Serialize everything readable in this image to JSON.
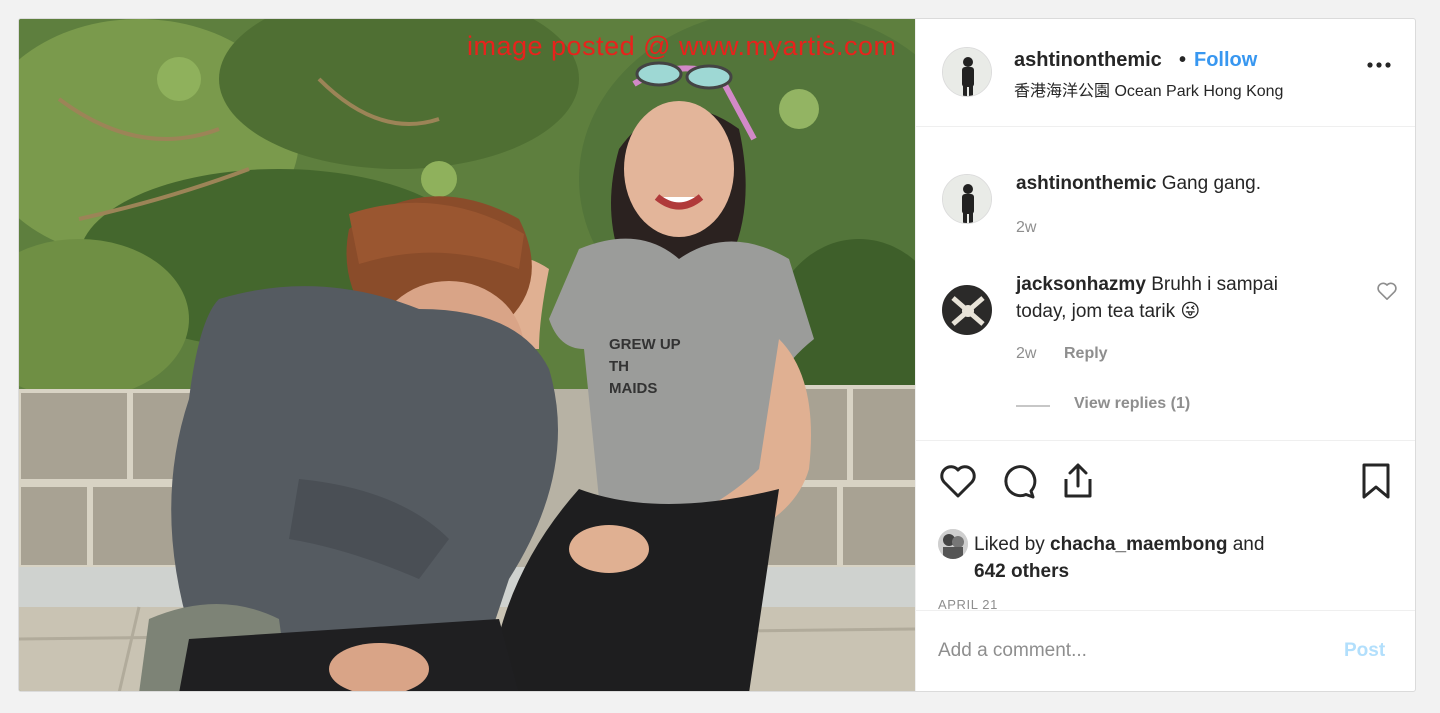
{
  "watermark": "image posted @ www.myartis.com",
  "photo": {
    "shirt_text_lines": [
      "GREW UP",
      "TH",
      "MAIDS"
    ]
  },
  "header": {
    "username": "ashtinonthemic",
    "separator": "•",
    "follow_label": "Follow",
    "location": "香港海洋公園 Ocean Park Hong Kong",
    "more_icon": "more-horizontal-icon"
  },
  "comments": [
    {
      "username": "ashtinonthemic",
      "text": "Gang gang.",
      "time": "2w"
    },
    {
      "username": "jacksonhazmy",
      "text": "Bruhh i sampai today, jom tea tarik 😜",
      "time": "2w",
      "reply_label": "Reply",
      "view_replies": "View replies (1)"
    }
  ],
  "actions": {
    "icons": [
      "heart-icon",
      "comment-icon",
      "share-icon",
      "bookmark-icon"
    ],
    "liked_by_prefix": "Liked by ",
    "liked_by_user": "chacha_maembong",
    "liked_by_and": " and",
    "liked_by_count": "642 others",
    "date": "APRIL 21"
  },
  "add_comment": {
    "placeholder": "Add a comment...",
    "post_label": "Post"
  },
  "colors": {
    "follow": "#3897f0",
    "post_disabled": "#b2dffc",
    "watermark": "#e8221c",
    "secondary_text": "#8e8e8e"
  }
}
